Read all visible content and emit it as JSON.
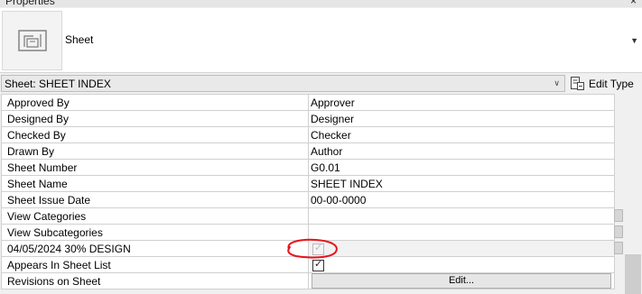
{
  "panel": {
    "title": "Properties",
    "close_glyph": "×"
  },
  "type_selector": {
    "name": "Sheet",
    "icon": "sheet-icon"
  },
  "instance_filter": {
    "selected": "Sheet: SHEET INDEX"
  },
  "edit_type": {
    "label": "Edit Type",
    "icon": "edit-type-icon"
  },
  "properties": {
    "rows": [
      {
        "name": "Approved By",
        "value": "Approver"
      },
      {
        "name": "Designed By",
        "value": "Designer"
      },
      {
        "name": "Checked By",
        "value": "Checker"
      },
      {
        "name": "Drawn By",
        "value": "Author"
      },
      {
        "name": "Sheet Number",
        "value": "G0.01"
      },
      {
        "name": "Sheet Name",
        "value": "SHEET INDEX"
      },
      {
        "name": "Sheet Issue Date",
        "value": "00-00-0000"
      },
      {
        "name": "View Categories",
        "value": ""
      },
      {
        "name": "View Subcategories",
        "value": ""
      },
      {
        "name": "04/05/2024  30% DESIGN",
        "checked": true,
        "disabled": true
      },
      {
        "name": "Appears In Sheet List",
        "checked": true,
        "disabled": false
      },
      {
        "name": "Revisions on Sheet",
        "button": "Edit..."
      }
    ]
  },
  "colors": {
    "annotation": "#e8131b",
    "grid_line": "#d0d0d0"
  }
}
